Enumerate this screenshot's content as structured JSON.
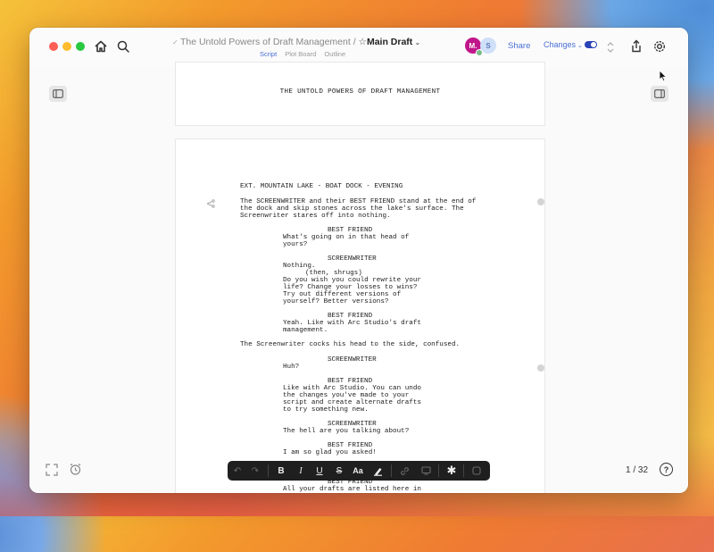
{
  "window": {
    "project_title": "The Untold Powers of Draft Management",
    "separator": "/",
    "draft_name": "Main Draft",
    "tabs": [
      "Script",
      "Plot Board",
      "Outline"
    ],
    "active_tab": "Script",
    "avatars": [
      "M.",
      "S"
    ],
    "share_label": "Share",
    "changes_label": "Changes"
  },
  "title_page": {
    "title": "THE UNTOLD POWERS OF DRAFT MANAGEMENT"
  },
  "script_lines": {
    "l01": "EXT. MOUNTAIN LAKE - BOAT DOCK - EVENING",
    "l02": "The SCREENWRITER and their BEST FRIEND stand at the end of",
    "l03": "the dock and skip stones across the lake's surface. The",
    "l04": "Screenwriter stares off into nothing.",
    "l05": "BEST FRIEND",
    "l06": "What's going on in that head of",
    "l07": "yours?",
    "l08": "SCREENWRITER",
    "l09": "Nothing.",
    "l10": "(then, shrugs)",
    "l11": "Do you wish you could rewrite your",
    "l12": "life? Change your losses to wins?",
    "l13": "Try out different versions of",
    "l14": "yourself? Better versions?",
    "l15": "BEST FRIEND",
    "l16": "Yeah. Like with Arc Studio's draft",
    "l17": "management.",
    "l18": "The Screenwriter cocks his head to the side, confused.",
    "l19": "SCREENWRITER",
    "l20": "Huh?",
    "l21": "BEST FRIEND",
    "l22": "Like with Arc Studio. You can undo",
    "l23": "the changes you've made to your",
    "l24": "script and create alternate drafts",
    "l25": "to try something new.",
    "l26": "SCREENWRITER",
    "l27": "The hell are you talking about?",
    "l28": "BEST FRIEND",
    "l29": "I am so glad you asked!",
    "l30": "BEST FRIEND",
    "l31": "All your drafts are listed here in"
  },
  "toolbar": {
    "bold": "B",
    "italic": "I",
    "underline": "U",
    "strike": "S",
    "case": "Aa",
    "note": "✱"
  },
  "footer": {
    "page_indicator": "1 / 32",
    "help": "?"
  },
  "colors": {
    "accent": "#4a6fd4",
    "toggle_on": "#2a44b8",
    "toolbar_bg": "#1f1f1f",
    "avatar_m": "#c0168b"
  }
}
